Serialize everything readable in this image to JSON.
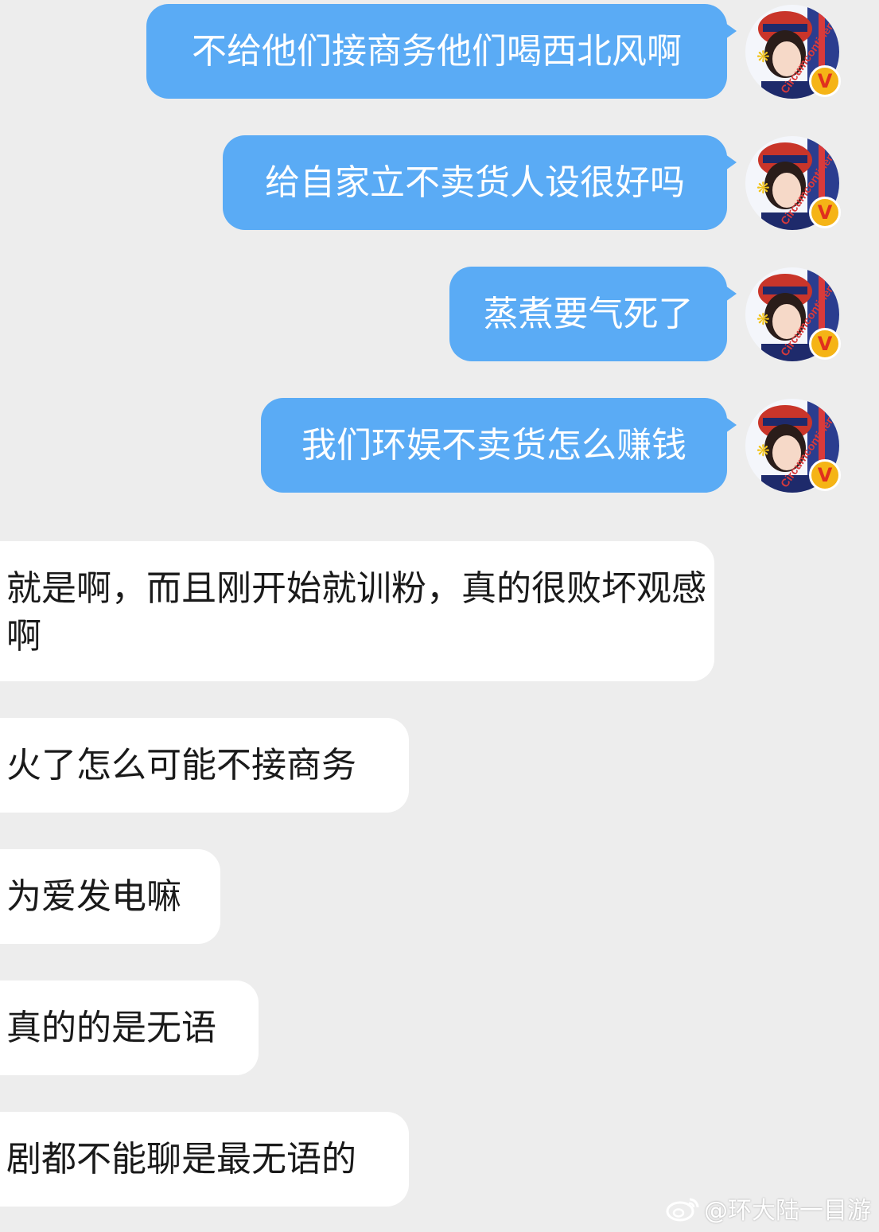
{
  "colors": {
    "background": "#ededed",
    "outgoing_bubble": "#5aabf5",
    "incoming_bubble": "#ffffff",
    "verified_badge": "#f5b416"
  },
  "sent_messages": [
    {
      "text": "不给他们接商务他们喝西北风啊"
    },
    {
      "text": "给自家立不卖货人设很好吗"
    },
    {
      "text": "蒸煮要气死了"
    },
    {
      "text": "我们环娱不卖货怎么赚钱"
    }
  ],
  "avatar": {
    "overlay_text": "Circumcontinental",
    "badge": "V",
    "icon": "avatar-photo"
  },
  "received_messages": [
    {
      "text": "就是啊，而且刚开始就训粉，真的很败坏观感啊"
    },
    {
      "text": "火了怎么可能不接商务"
    },
    {
      "text": "为爱发电嘛"
    },
    {
      "text": "真的的是无语"
    },
    {
      "text": "剧都不能聊是最无语的"
    }
  ],
  "watermark": {
    "icon": "weibo-icon",
    "text": "@环大陆一目游"
  }
}
